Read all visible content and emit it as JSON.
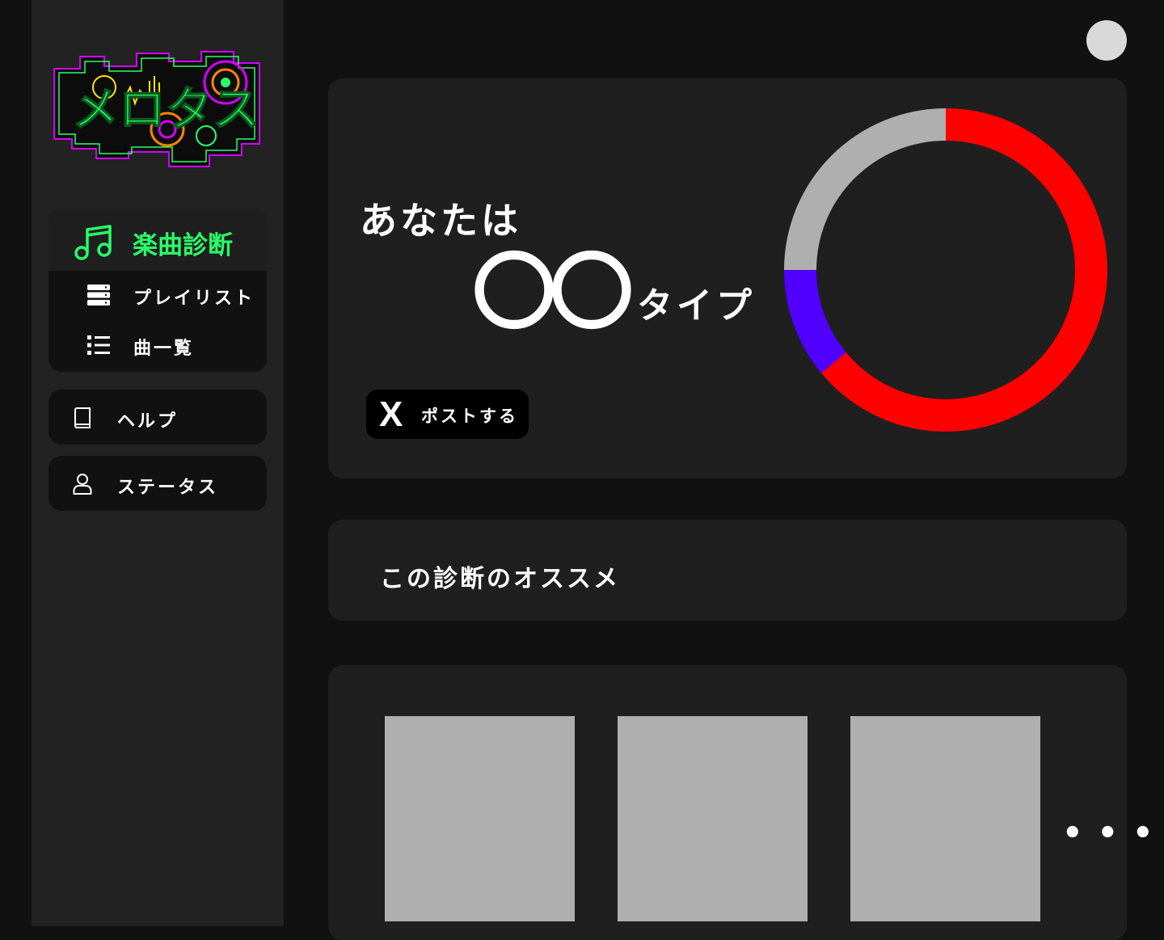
{
  "sidebar": {
    "logo_text": "メロタス",
    "nav_head": {
      "label": "楽曲診断",
      "icon": "music-note-icon",
      "color": "#29ff6a"
    },
    "nav_sub": [
      {
        "label": "プレイリスト",
        "icon": "playlist-icon"
      },
      {
        "label": "曲一覧",
        "icon": "list-icon"
      }
    ],
    "help": {
      "label": "ヘルプ",
      "icon": "book-icon"
    },
    "status": {
      "label": "ステータス",
      "icon": "user-icon"
    }
  },
  "result": {
    "headline": "あなたは",
    "type_name": "〇〇",
    "type_suffix": "タイプ",
    "post_label": "ポストする",
    "post_icon_text": "X",
    "donut": {
      "segments": [
        {
          "value": 64,
          "color": "#ff0000"
        },
        {
          "value": 11,
          "color": "#5000ff"
        },
        {
          "value": 25,
          "color": "#afafaf"
        }
      ]
    }
  },
  "recommendations": {
    "title": "この診断のオススメ",
    "items": [
      {},
      {},
      {}
    ],
    "more_label": "• • •"
  },
  "colors": {
    "accent": "#29ff6a",
    "background": "#111111",
    "panel": "#1f1f1f",
    "sidebar": "#222222"
  }
}
